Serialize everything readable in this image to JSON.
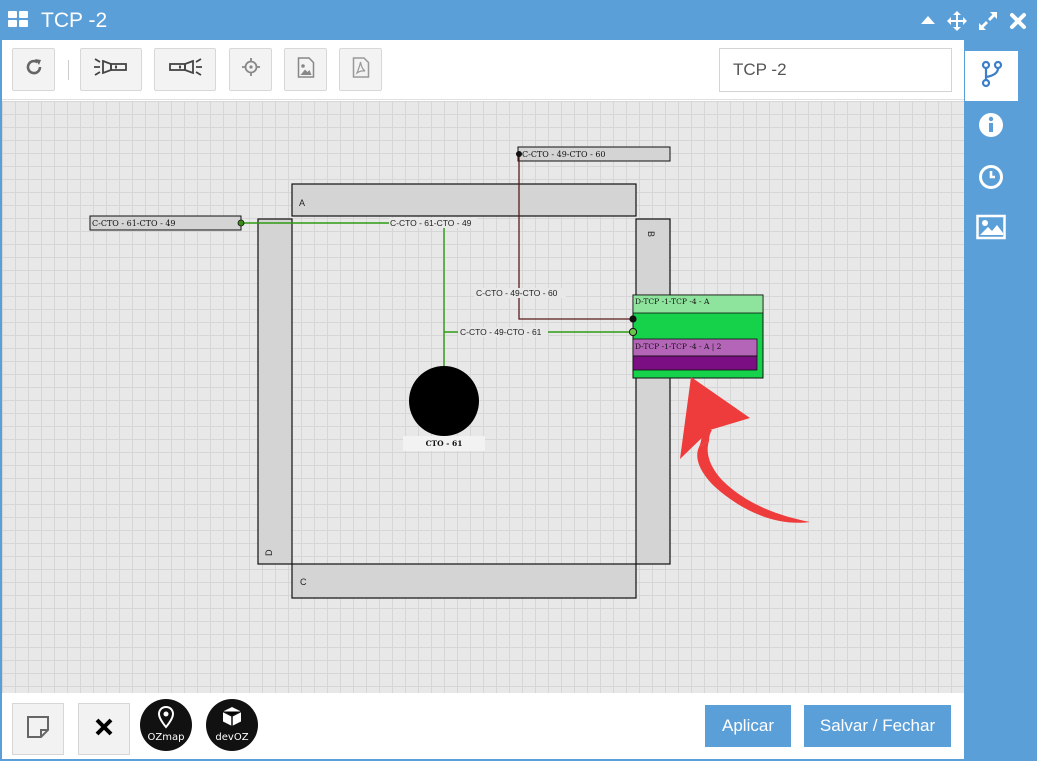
{
  "window": {
    "title": "TCP -2",
    "controls": [
      "collapse-icon",
      "move-icon",
      "expand-icon",
      "close-icon"
    ]
  },
  "toolbar": {
    "buttons": [
      "refresh-icon",
      "flashlight-on-icon",
      "flashlight-off-icon",
      "crosshair-icon",
      "image-icon",
      "pdf-icon"
    ],
    "name_value": "TCP -2"
  },
  "sidebar": {
    "tabs": [
      "branch-icon",
      "info-icon",
      "clock-icon",
      "picture-icon"
    ],
    "active": "branch-icon"
  },
  "diagram": {
    "sides": {
      "a": "A",
      "b": "B",
      "c": "C",
      "d": "D"
    },
    "cables": {
      "top": "C-CTO - 49-CTO - 60",
      "left": "C-CTO - 61-CTO - 49"
    },
    "fiber_labels": {
      "horizontal": "C-CTO - 61-CTO - 49",
      "vertical": "C-CTO - 49-CTO - 60",
      "green": "C-CTO - 49-CTO - 61"
    },
    "device": {
      "title": "D-TCP -1-TCP -4 - A",
      "port": "D-TCP -1-TCP -4 - A | 2"
    },
    "node": "CTO - 61",
    "colors": {
      "fiber_green": "#2e9a13",
      "fiber_dark": "#5a1a1a",
      "device_green": "#16d24a",
      "device_header": "#8ee39d",
      "port_purple": "#b565b8",
      "port_dark": "#7a0e82",
      "arrow_red": "#ee3b3b"
    }
  },
  "footer": {
    "logos": {
      "ozmap": "OZmap",
      "devoz": "devOZ"
    },
    "apply_label": "Aplicar",
    "save_close_label": "Salvar / Fechar"
  }
}
